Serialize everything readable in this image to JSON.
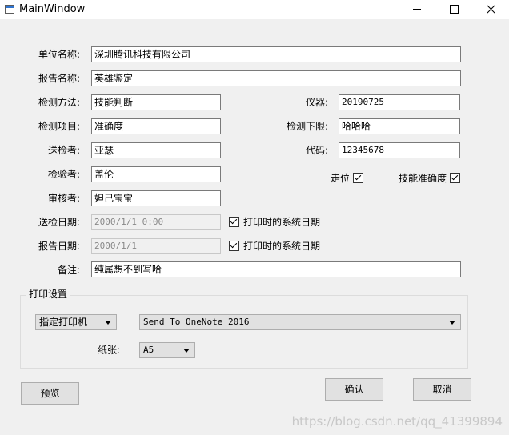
{
  "window": {
    "title": "MainWindow"
  },
  "form": {
    "unit_name": {
      "label": "单位名称:",
      "value": "深圳腾讯科技有限公司"
    },
    "report_name": {
      "label": "报告名称:",
      "value": "英雄鉴定"
    },
    "method": {
      "label": "检测方法:",
      "value": "技能判断"
    },
    "instrument": {
      "label": "仪器:",
      "value": "20190725"
    },
    "item": {
      "label": "检测项目:",
      "value": "准确度"
    },
    "lower_limit": {
      "label": "检测下限:",
      "value": "哈哈哈"
    },
    "sender": {
      "label": "送检者:",
      "value": "亚瑟"
    },
    "code": {
      "label": "代码:",
      "value": "12345678"
    },
    "inspector": {
      "label": "检验者:",
      "value": "盖伦"
    },
    "reviewer": {
      "label": "审核者:",
      "value": "妲己宝宝"
    },
    "walk_checkbox": {
      "label": "走位",
      "checked": true
    },
    "skill_checkbox": {
      "label": "技能准确度",
      "checked": true
    },
    "send_date": {
      "label": "送检日期:",
      "value": "2000/1/1 0:00"
    },
    "send_date_sys": {
      "label": "打印时的系统日期",
      "checked": true
    },
    "report_date": {
      "label": "报告日期:",
      "value": "2000/1/1"
    },
    "report_date_sys": {
      "label": "打印时的系统日期",
      "checked": true
    },
    "remark": {
      "label": "备注:",
      "value": "纯属想不到写哈"
    }
  },
  "print": {
    "group_title": "打印设置",
    "printer_mode": "指定打印机",
    "printer": "Send To OneNote 2016",
    "paper_label": "纸张:",
    "paper": "A5"
  },
  "buttons": {
    "preview": "预览",
    "confirm": "确认",
    "cancel": "取消"
  },
  "watermark": "https://blog.csdn.net/qq_41399894"
}
